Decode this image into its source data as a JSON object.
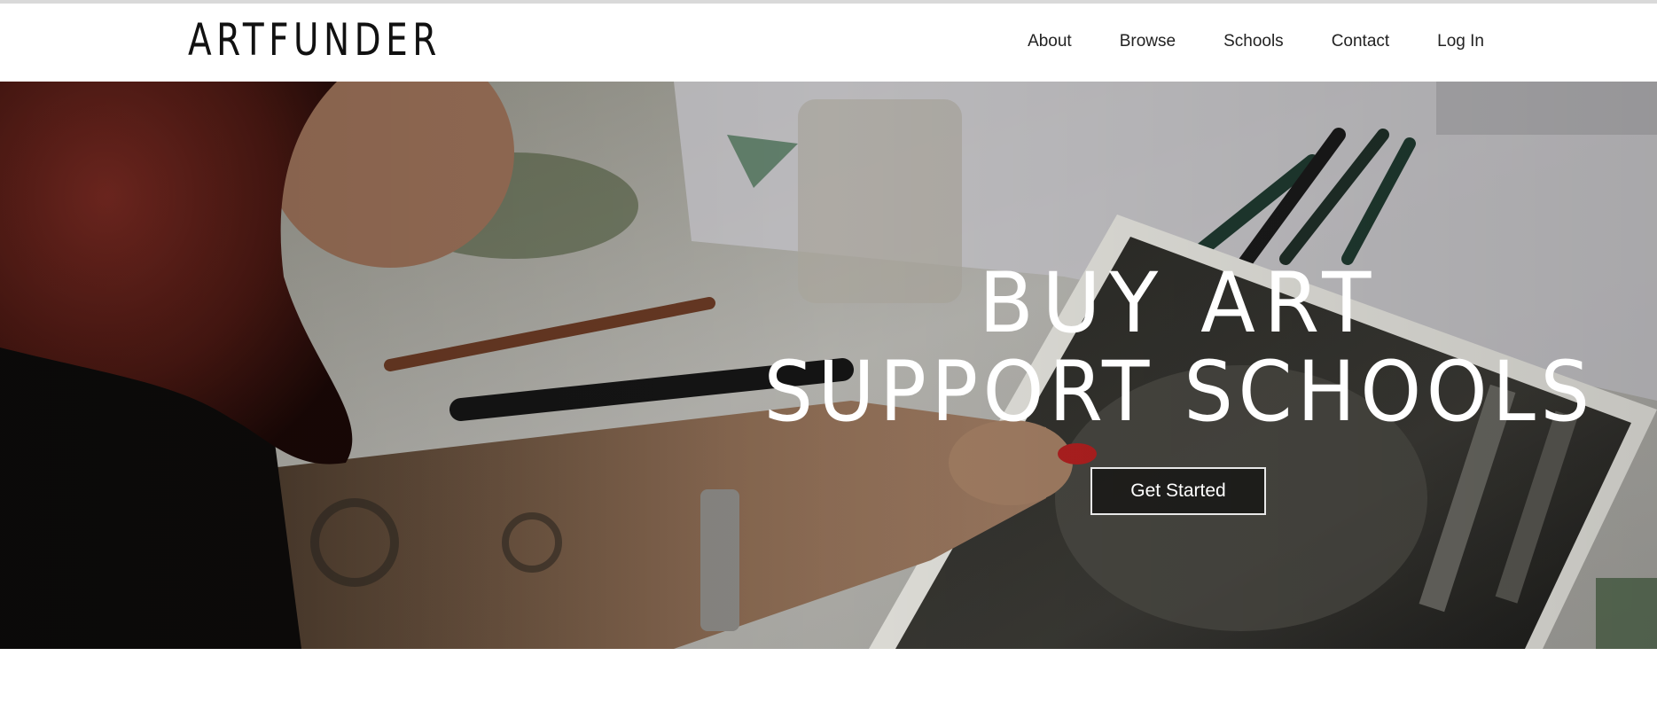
{
  "header": {
    "logo_text": "ARTFUNDER",
    "nav_items": [
      {
        "label": "About"
      },
      {
        "label": "Browse"
      },
      {
        "label": "Schools"
      },
      {
        "label": "Contact"
      },
      {
        "label": "Log In"
      }
    ]
  },
  "hero": {
    "headline_line_1": "BUY ART",
    "headline_line_2": "SUPPORT SCHOOLS",
    "cta_label": "Get Started",
    "photo_subject": "person-drawing-at-table-with-photo-of-elephant"
  },
  "colors": {
    "text_dark": "#111111",
    "hero_text": "#ffffff",
    "nav_background": "#ffffff"
  }
}
